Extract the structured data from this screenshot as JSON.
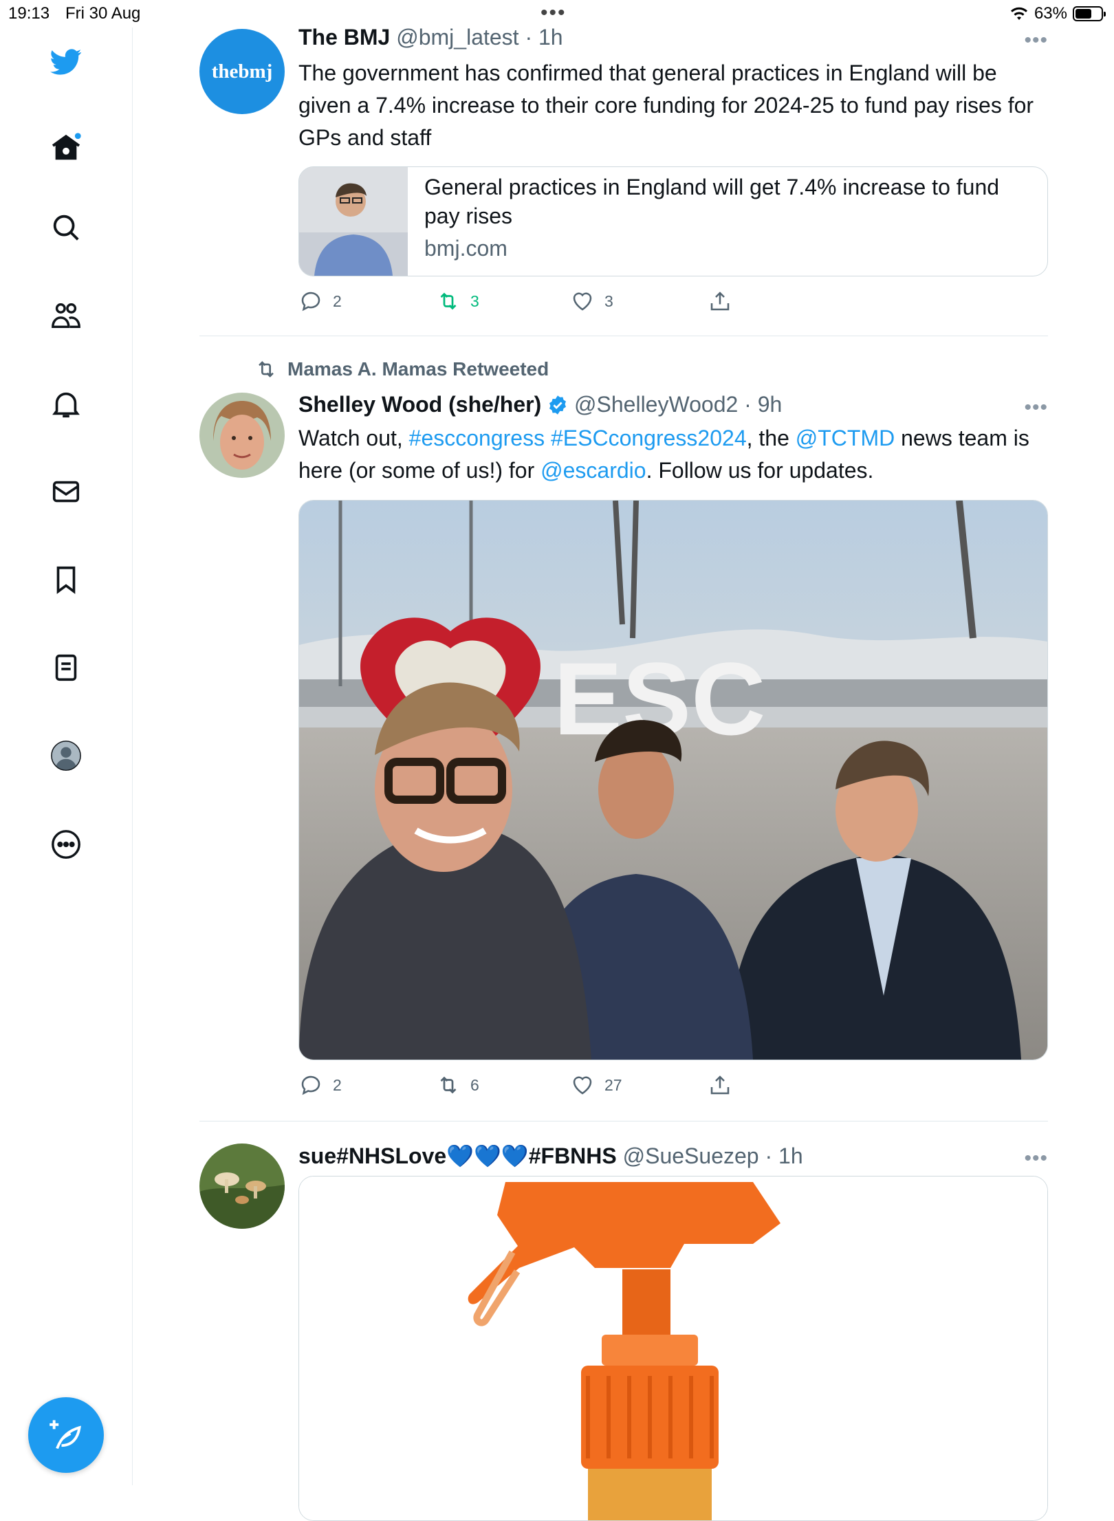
{
  "status": {
    "time": "19:13",
    "date": "Fri 30 Aug",
    "battery": "63%",
    "battery_level": 0.63
  },
  "colors": {
    "accent": "#1d9bf0",
    "retweet": "#00ba7c",
    "text": "#0f1419",
    "muted": "#536471"
  },
  "nav": {
    "logo": "twitter-bird-icon",
    "items": [
      "home-icon",
      "search-icon",
      "communities-icon",
      "notifications-icon",
      "messages-icon",
      "bookmarks-icon",
      "lists-icon",
      "profile-icon",
      "more-icon"
    ]
  },
  "tweets": [
    {
      "avatar_text": "thebmj",
      "name": "The BMJ",
      "handle": "@bmj_latest",
      "time": "· 1h",
      "text": "The government has confirmed that general practices in England will be given a 7.4% increase to their core funding for 2024-25 to fund pay rises for GPs and staff",
      "card": {
        "title": "General practices in England will get 7.4% increase to fund pay rises",
        "domain": "bmj.com"
      },
      "replies": "2",
      "retweets": "3",
      "likes": "3"
    },
    {
      "retweeted_by": "Mamas A. Mamas Retweeted",
      "name": "Shelley Wood (she/her)",
      "handle": "@ShelleyWood2",
      "time": "· 9h",
      "text_parts": [
        "Watch out, ",
        "#esccongress",
        " ",
        "#ESCcongress2024",
        ", the ",
        "@TCTMD",
        " news team is here (or some of us!) for ",
        "@escardio",
        ". Follow us for updates."
      ],
      "replies": "2",
      "retweets": "6",
      "likes": "27"
    },
    {
      "name": "sue#NHSLove💙💙💙#FBNHS",
      "handle": "@SueSuezep",
      "time": "· 1h"
    }
  ]
}
